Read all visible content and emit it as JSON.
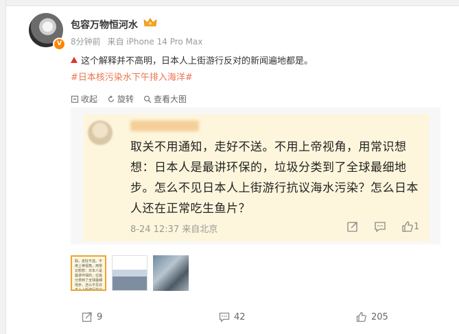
{
  "post": {
    "username": "包容万物恒河水",
    "time": "8分钟前",
    "source": "来自 iPhone 14 Pro Max",
    "text": "这个解释并不高明，日本人上街游行反对的新闻遍地都是。",
    "hashtag": "#日本核污染水下午排入海洋#"
  },
  "actions": {
    "collapse": "收起",
    "rotate": "旋转",
    "view_large": "查看大图"
  },
  "quoted": {
    "text": "取关不用通知，走好不送。不用上帝视角，用常识想想：日本人是最讲环保的，垃圾分类到了全球最细地步。怎么不见日本人上街游行抗议海水污染？怎么日本人还在正常吃生鱼片？",
    "meta": "8-24 12:37 来自北京",
    "like_count": "1"
  },
  "thumbnails": {
    "thumb1_text": "取，走好不送。不用上帝视角，用常识想想：日本人是最讲环保的，垃圾分类到了全球最细地步。怎么不见日本人上街游行抗议海水污染？怎么日本人还在正常吃生鱼片？"
  },
  "footer": {
    "reposts": "9",
    "comments": "42",
    "likes": "205"
  },
  "colors": {
    "hashtag": "#eb7350",
    "badge": "#ff8200",
    "highlight": "#fdf6dc"
  }
}
